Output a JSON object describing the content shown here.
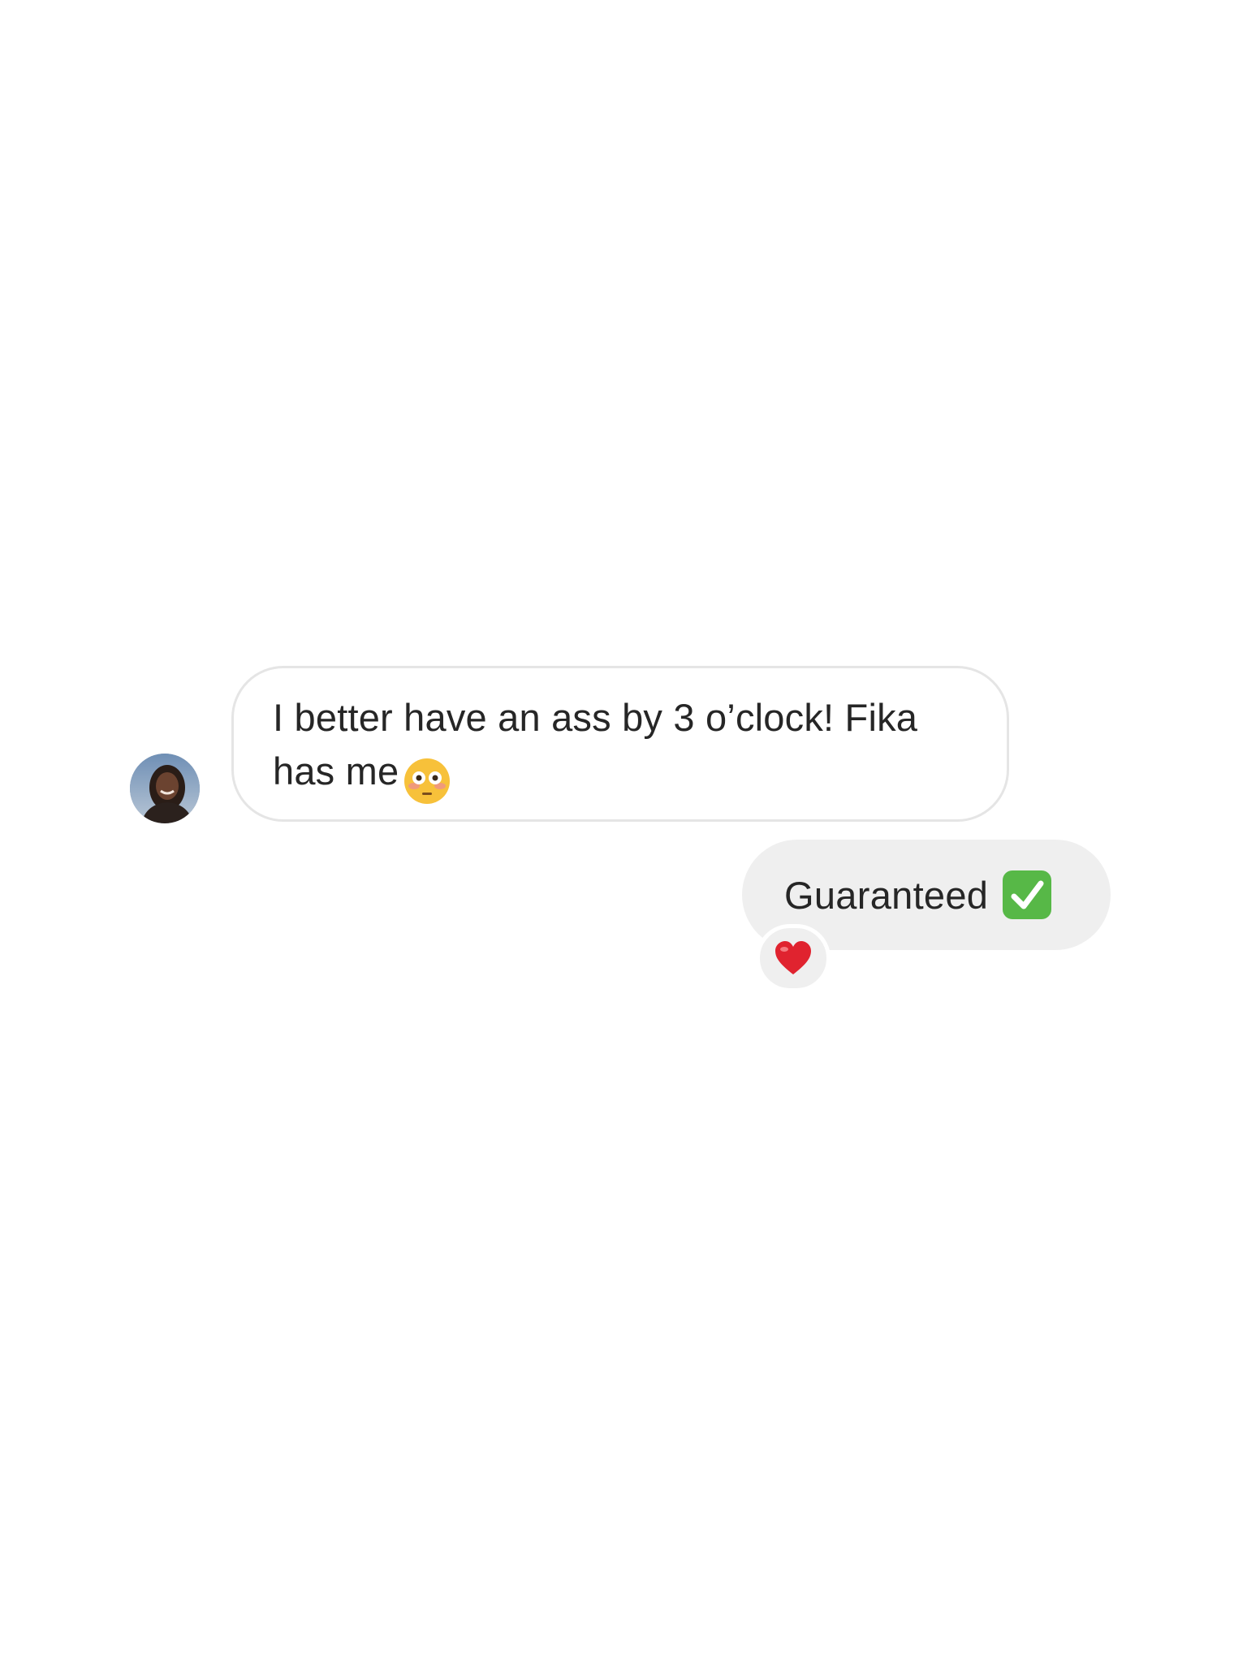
{
  "thread": {
    "received_message": {
      "text": "I better have an ass by 3 o’clock! Fika has me",
      "emoji": "flushed-face-emoji"
    },
    "sent_message": {
      "text": "Guaranteed",
      "emoji": "check-mark-button-emoji"
    },
    "reaction": {
      "emoji": "red-heart-emoji"
    }
  },
  "colors": {
    "background": "#ffffff",
    "received_bubble_border": "#e5e5e5",
    "sent_bubble_fill": "#efefef",
    "text": "#262626"
  }
}
